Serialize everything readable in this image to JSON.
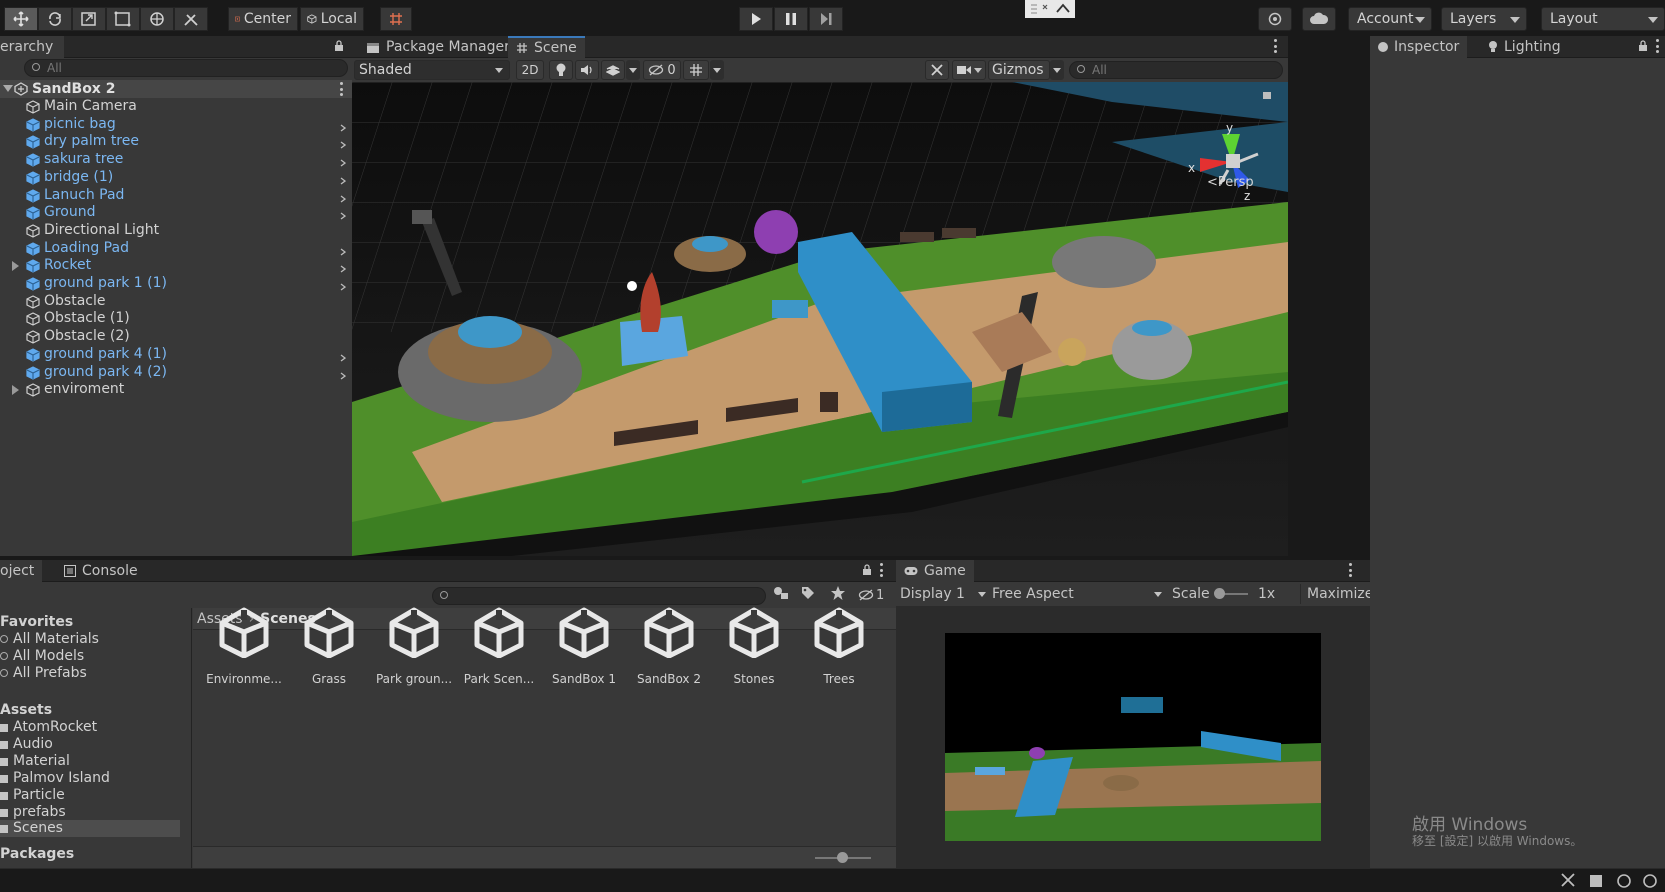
{
  "toolbar": {
    "pivot_label": "Center",
    "space_label": "Local",
    "account_label": "Account",
    "layers_label": "Layers",
    "layout_label": "Layout"
  },
  "hierarchy": {
    "tab_label": "erarchy",
    "search_placeholder": "All",
    "scene_name": "SandBox 2",
    "items": [
      {
        "label": "Main Camera",
        "prefab": false,
        "expand": false,
        "child": false
      },
      {
        "label": "picnic bag",
        "prefab": true,
        "expand": false,
        "child": true
      },
      {
        "label": "dry palm tree",
        "prefab": true,
        "expand": false,
        "child": true
      },
      {
        "label": "sakura tree",
        "prefab": true,
        "expand": false,
        "child": true
      },
      {
        "label": "bridge (1)",
        "prefab": true,
        "expand": false,
        "child": true
      },
      {
        "label": "Lanuch Pad",
        "prefab": true,
        "expand": false,
        "child": true
      },
      {
        "label": "Ground",
        "prefab": true,
        "expand": false,
        "child": true
      },
      {
        "label": "Directional Light",
        "prefab": false,
        "expand": false,
        "child": false
      },
      {
        "label": "Loading Pad",
        "prefab": true,
        "expand": false,
        "child": true
      },
      {
        "label": "Rocket",
        "prefab": true,
        "expand": true,
        "child": true
      },
      {
        "label": "ground park 1 (1)",
        "prefab": true,
        "expand": false,
        "child": true
      },
      {
        "label": "Obstacle",
        "prefab": false,
        "expand": false,
        "child": false
      },
      {
        "label": "Obstacle (1)",
        "prefab": false,
        "expand": false,
        "child": false
      },
      {
        "label": "Obstacle (2)",
        "prefab": false,
        "expand": false,
        "child": false
      },
      {
        "label": "ground park 4 (1)",
        "prefab": true,
        "expand": false,
        "child": true
      },
      {
        "label": "ground park 4 (2)",
        "prefab": true,
        "expand": false,
        "child": true
      },
      {
        "label": "enviroment",
        "prefab": false,
        "expand": true,
        "child": false
      }
    ]
  },
  "scene_view": {
    "tabs": [
      "Package Manager",
      "Scene"
    ],
    "shading_mode": "Shaded",
    "toggle_2d": "2D",
    "hidden_count": "0",
    "gizmos_label": "Gizmos",
    "search_placeholder": "All",
    "persp_label": "Persp",
    "axis_x": "x",
    "axis_y": "y",
    "axis_z": "z"
  },
  "inspector": {
    "tabs": [
      "Inspector",
      "Lighting"
    ]
  },
  "project": {
    "tabs": [
      "oject",
      "Console"
    ],
    "hidden_count": "1",
    "favorites_header": "Favorites",
    "favorites": [
      "All Materials",
      "All Models",
      "All Prefabs"
    ],
    "assets_header": "Assets",
    "folders": [
      "AtomRocket",
      "Audio",
      "Material",
      "Palmov Island",
      "Particle",
      "prefabs",
      "Scenes"
    ],
    "selected_folder": "Scenes",
    "packages_header": "Packages",
    "breadcrumb_root": "Assets",
    "breadcrumb_current": "Scenes",
    "assets": [
      "Environme...",
      "Grass",
      "Park groun...",
      "Park Scen...",
      "SandBox 1",
      "SandBox 2",
      "Stones",
      "Trees"
    ]
  },
  "game_view": {
    "tab_label": "Game",
    "display": "Display 1",
    "aspect": "Free Aspect",
    "scale_label": "Scale",
    "scale_value": "1x",
    "maximize_label": "Maximize"
  },
  "watermark": {
    "line1": "啟用 Windows",
    "line2": "移至 [設定] 以啟用 Windows。"
  },
  "colors": {
    "accent": "#3a79bb",
    "prefab_text": "#7bb7f2",
    "panel_bg": "#383838",
    "toolbar_bg": "#191919"
  }
}
